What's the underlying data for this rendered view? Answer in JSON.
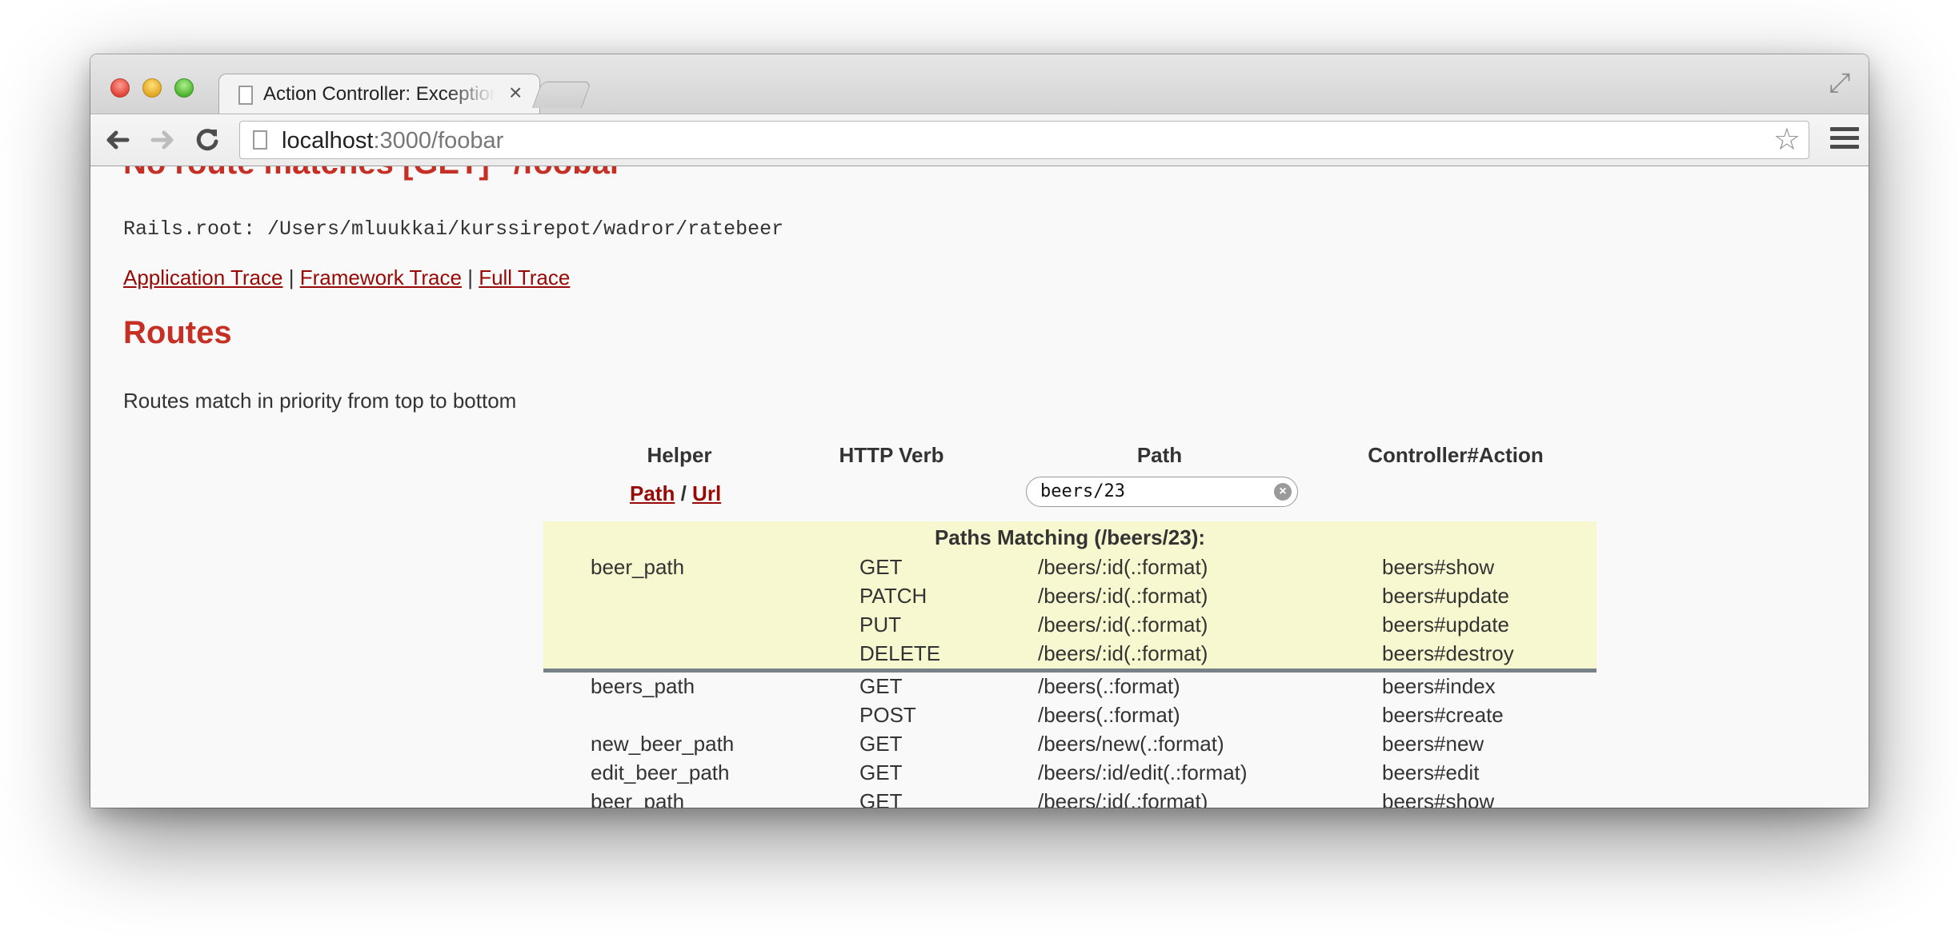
{
  "browser": {
    "tab_title": "Action Controller: Exception caught",
    "tab_close": "×",
    "url_host": "localhost",
    "url_rest": ":3000/foobar",
    "icons": [
      "back-icon",
      "forward-icon",
      "reload-icon",
      "page-icon",
      "bookmark-star-icon",
      "menu-icon",
      "fullscreen-icon"
    ]
  },
  "page": {
    "error_heading": "No route matches [GET] \"/foobar\"",
    "rails_root": "Rails.root: /Users/mluukkai/kurssirepot/wadror/ratebeer",
    "trace_links": [
      "Application Trace",
      "Framework Trace",
      "Full Trace"
    ],
    "trace_sep": "|",
    "routes_heading": "Routes",
    "routes_intro": "Routes match in priority from top to bottom"
  },
  "routes_table": {
    "headers": [
      "Helper",
      "HTTP Verb",
      "Path",
      "Controller#Action"
    ],
    "path_link": "Path",
    "slash": "/",
    "url_link": "Url",
    "search_value": "beers/23",
    "match_title": "Paths Matching (/beers/23):",
    "matches": [
      [
        "beer_path",
        "GET",
        "/beers/:id(.:format)",
        "beers#show"
      ],
      [
        "",
        "PATCH",
        "/beers/:id(.:format)",
        "beers#update"
      ],
      [
        "",
        "PUT",
        "/beers/:id(.:format)",
        "beers#update"
      ],
      [
        "",
        "DELETE",
        "/beers/:id(.:format)",
        "beers#destroy"
      ]
    ],
    "rows": [
      [
        "beers_path",
        "GET",
        "/beers(.:format)",
        "beers#index"
      ],
      [
        "",
        "POST",
        "/beers(.:format)",
        "beers#create"
      ],
      [
        "new_beer_path",
        "GET",
        "/beers/new(.:format)",
        "beers#new"
      ],
      [
        "edit_beer_path",
        "GET",
        "/beers/:id/edit(.:format)",
        "beers#edit"
      ],
      [
        "beer_path",
        "GET",
        "/beers/:id(.:format)",
        "beers#show"
      ]
    ]
  },
  "colors": {
    "heading_red": "#c52f24",
    "link_red": "#980905",
    "match_bg": "#f8f8d0",
    "match_border": "#778188"
  }
}
